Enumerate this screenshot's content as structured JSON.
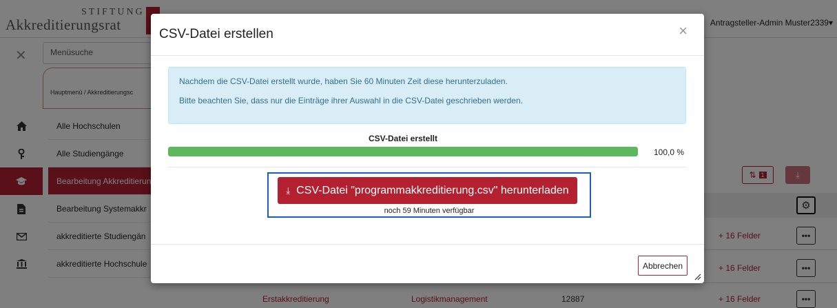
{
  "header": {
    "logo_line1": "STIFTUNG",
    "logo_line2": "Akkreditierungsrat",
    "user": "Antragsteller-Admin Muster2339▾"
  },
  "sidebar": {
    "search_placeholder": "Menüsuche",
    "close_glyph": "✕",
    "breadcrumb": "Hauptmenü / Akkreditierungsc",
    "items": [
      {
        "label": "Alle Hochschulen",
        "icon": "home-icon"
      },
      {
        "label": "Alle Studiengänge",
        "icon": "key-icon"
      },
      {
        "label": "Bearbeitung Akkreditierun",
        "icon": "graduation-cap-icon",
        "active": true
      },
      {
        "label": "Bearbeitung Systemakkr",
        "icon": "document-icon"
      },
      {
        "label": "akkreditierte Studiengän",
        "icon": "envelope-icon"
      },
      {
        "label": "akkreditierte Hochschule",
        "icon": "institution-icon"
      }
    ]
  },
  "table": {
    "badge": "1",
    "sort_glyph": "⇅",
    "download_glyph": "⤓",
    "gear_glyph": "⚙",
    "fields_label": "+ 16 Felder",
    "dots": "•••",
    "visible_row": {
      "type": "Erstakkreditierung",
      "program": "Logistikmanagement",
      "id": "12887"
    }
  },
  "modal": {
    "title": "CSV-Datei erstellen",
    "close_glyph": "×",
    "alert_line1": "Nachdem die CSV-Datei erstellt wurde, haben Sie 60 Minuten Zeit diese herunterzuladen.",
    "alert_line2": "Bitte beachten Sie, dass nur die Einträge ihrer Auswahl in die CSV-Datei geschrieben werden.",
    "progress_label": "CSV-Datei erstellt",
    "progress_value": 1.0,
    "progress_text": "100,0 %",
    "download_label": "CSV-Datei \"programmakkreditierung.csv\" herunterladen",
    "download_glyph": "⤓",
    "availability": "noch 59 Minuten verfügbar",
    "cancel_label": "Abbrechen"
  },
  "colors": {
    "brand": "#b32030",
    "progress": "#5cb85c",
    "alert_bg": "#d9edf7",
    "highlight": "#1a5fc0"
  }
}
